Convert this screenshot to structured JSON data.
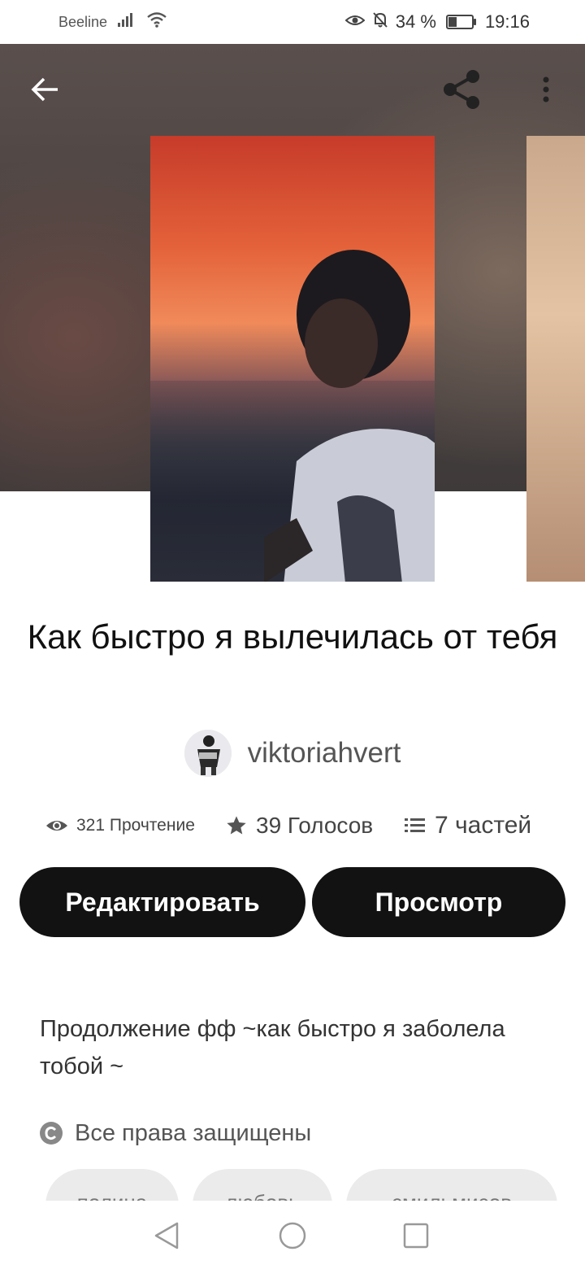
{
  "status_bar": {
    "carrier": "Beeline",
    "battery": "34 %",
    "time": "19:16"
  },
  "header": {
    "back_icon": "arrow-left-icon",
    "share_icon": "share-icon",
    "more_icon": "more-vertical-icon"
  },
  "story": {
    "title": "Как быстро я вылечилась от тебя",
    "author": "viktoriahvert",
    "stats": {
      "reads": "321 Прочтение",
      "votes": "39 Голосов",
      "parts": "7 частей"
    },
    "description": "Продолжение фф ~как быстро я заболела тобой ~",
    "rights": "Все права защищены"
  },
  "actions": {
    "edit_label": "Редактировать",
    "preview_label": "Просмотр"
  },
  "tags": [
    "полина",
    "любовь",
    "смильмисов"
  ],
  "colors": {
    "button_bg": "#121212",
    "button_text": "#ffffff",
    "tag_bg": "#ebebeb"
  },
  "nav": {
    "back": "triangle-back-icon",
    "home": "circle-home-icon",
    "recents": "square-recents-icon"
  }
}
